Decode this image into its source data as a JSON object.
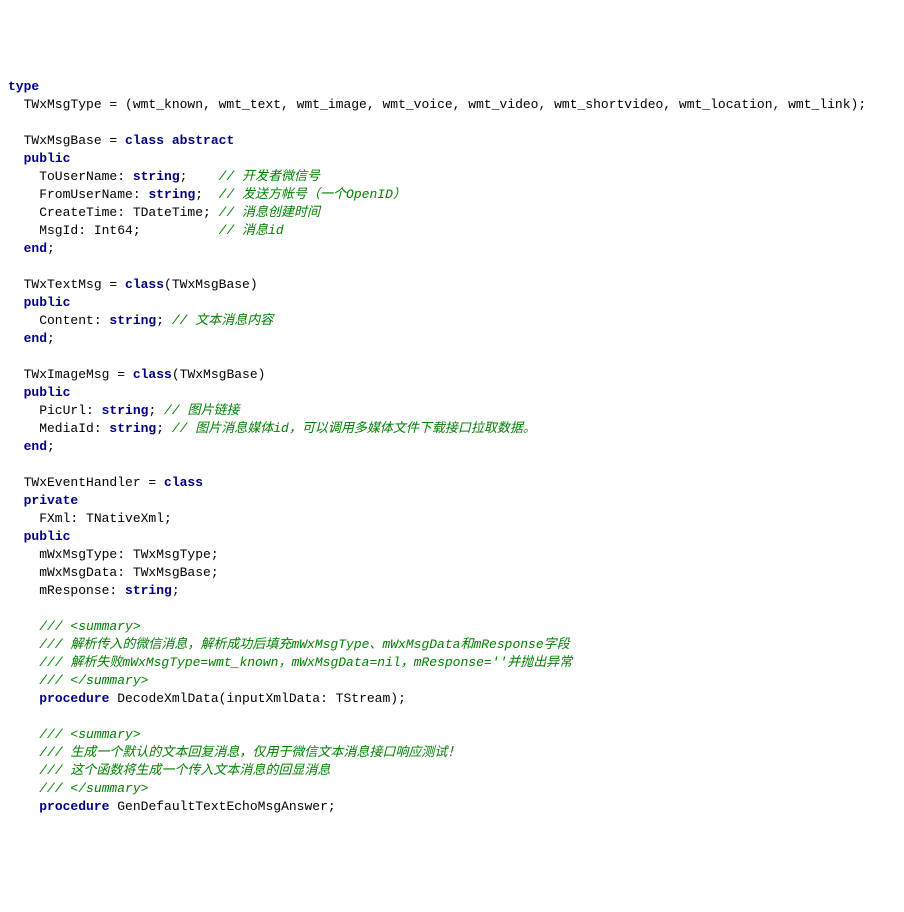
{
  "lines": [
    {
      "type": "kw",
      "text": "type"
    },
    {
      "segs": [
        {
          "t": "p",
          "v": "  TWxMsgType = (wmt_known, wmt_text, wmt_image, wmt_voice, wmt_video, wmt_shortvideo, wmt_location, wmt_link);"
        }
      ]
    },
    {
      "segs": [
        {
          "t": "p",
          "v": ""
        }
      ]
    },
    {
      "segs": [
        {
          "t": "p",
          "v": "  TWxMsgBase = "
        },
        {
          "t": "kw",
          "v": "class abstract"
        }
      ]
    },
    {
      "segs": [
        {
          "t": "p",
          "v": "  "
        },
        {
          "t": "kw",
          "v": "public"
        }
      ]
    },
    {
      "segs": [
        {
          "t": "p",
          "v": "    ToUserName: "
        },
        {
          "t": "typ",
          "v": "string"
        },
        {
          "t": "p",
          "v": ";    "
        },
        {
          "t": "cmt",
          "v": "// 开发者微信号"
        }
      ]
    },
    {
      "segs": [
        {
          "t": "p",
          "v": "    FromUserName: "
        },
        {
          "t": "typ",
          "v": "string"
        },
        {
          "t": "p",
          "v": ";  "
        },
        {
          "t": "cmt",
          "v": "// 发送方帐号（一个OpenID）"
        }
      ]
    },
    {
      "segs": [
        {
          "t": "p",
          "v": "    CreateTime: TDateTime; "
        },
        {
          "t": "cmt",
          "v": "// 消息创建时间"
        }
      ]
    },
    {
      "segs": [
        {
          "t": "p",
          "v": "    MsgId: Int64;          "
        },
        {
          "t": "cmt",
          "v": "// 消息id"
        }
      ]
    },
    {
      "segs": [
        {
          "t": "p",
          "v": "  "
        },
        {
          "t": "kw",
          "v": "end"
        },
        {
          "t": "p",
          "v": ";"
        }
      ]
    },
    {
      "segs": [
        {
          "t": "p",
          "v": ""
        }
      ]
    },
    {
      "segs": [
        {
          "t": "p",
          "v": "  TWxTextMsg = "
        },
        {
          "t": "kw",
          "v": "class"
        },
        {
          "t": "p",
          "v": "(TWxMsgBase)"
        }
      ]
    },
    {
      "segs": [
        {
          "t": "p",
          "v": "  "
        },
        {
          "t": "kw",
          "v": "public"
        }
      ]
    },
    {
      "segs": [
        {
          "t": "p",
          "v": "    Content: "
        },
        {
          "t": "typ",
          "v": "string"
        },
        {
          "t": "p",
          "v": "; "
        },
        {
          "t": "cmt",
          "v": "// 文本消息内容"
        }
      ]
    },
    {
      "segs": [
        {
          "t": "p",
          "v": "  "
        },
        {
          "t": "kw",
          "v": "end"
        },
        {
          "t": "p",
          "v": ";"
        }
      ]
    },
    {
      "segs": [
        {
          "t": "p",
          "v": ""
        }
      ]
    },
    {
      "segs": [
        {
          "t": "p",
          "v": "  TWxImageMsg = "
        },
        {
          "t": "kw",
          "v": "class"
        },
        {
          "t": "p",
          "v": "(TWxMsgBase)"
        }
      ]
    },
    {
      "segs": [
        {
          "t": "p",
          "v": "  "
        },
        {
          "t": "kw",
          "v": "public"
        }
      ]
    },
    {
      "segs": [
        {
          "t": "p",
          "v": "    PicUrl: "
        },
        {
          "t": "typ",
          "v": "string"
        },
        {
          "t": "p",
          "v": "; "
        },
        {
          "t": "cmt",
          "v": "// 图片链接"
        }
      ]
    },
    {
      "segs": [
        {
          "t": "p",
          "v": "    MediaId: "
        },
        {
          "t": "typ",
          "v": "string"
        },
        {
          "t": "p",
          "v": "; "
        },
        {
          "t": "cmt",
          "v": "// 图片消息媒体id，可以调用多媒体文件下载接口拉取数据。"
        }
      ]
    },
    {
      "segs": [
        {
          "t": "p",
          "v": "  "
        },
        {
          "t": "kw",
          "v": "end"
        },
        {
          "t": "p",
          "v": ";"
        }
      ]
    },
    {
      "segs": [
        {
          "t": "p",
          "v": ""
        }
      ]
    },
    {
      "segs": [
        {
          "t": "p",
          "v": "  TWxEventHandler = "
        },
        {
          "t": "kw",
          "v": "class"
        }
      ]
    },
    {
      "segs": [
        {
          "t": "p",
          "v": "  "
        },
        {
          "t": "kw",
          "v": "private"
        }
      ]
    },
    {
      "segs": [
        {
          "t": "p",
          "v": "    FXml: TNativeXml;"
        }
      ]
    },
    {
      "segs": [
        {
          "t": "p",
          "v": "  "
        },
        {
          "t": "kw",
          "v": "public"
        }
      ]
    },
    {
      "segs": [
        {
          "t": "p",
          "v": "    mWxMsgType: TWxMsgType;"
        }
      ]
    },
    {
      "segs": [
        {
          "t": "p",
          "v": "    mWxMsgData: TWxMsgBase;"
        }
      ]
    },
    {
      "segs": [
        {
          "t": "p",
          "v": "    mResponse: "
        },
        {
          "t": "typ",
          "v": "string"
        },
        {
          "t": "p",
          "v": ";"
        }
      ]
    },
    {
      "segs": [
        {
          "t": "p",
          "v": ""
        }
      ]
    },
    {
      "segs": [
        {
          "t": "p",
          "v": "    "
        },
        {
          "t": "cmt",
          "v": "/// <summary>"
        }
      ]
    },
    {
      "segs": [
        {
          "t": "p",
          "v": "    "
        },
        {
          "t": "cmt",
          "v": "/// 解析传入的微信消息，解析成功后填充mWxMsgType、mWxMsgData和mResponse字段"
        }
      ]
    },
    {
      "segs": [
        {
          "t": "p",
          "v": "    "
        },
        {
          "t": "cmt",
          "v": "/// 解析失败mWxMsgType=wmt_known，mWxMsgData=nil，mResponse=''并抛出异常"
        }
      ]
    },
    {
      "segs": [
        {
          "t": "p",
          "v": "    "
        },
        {
          "t": "cmt",
          "v": "/// </summary>"
        }
      ]
    },
    {
      "segs": [
        {
          "t": "p",
          "v": "    "
        },
        {
          "t": "kw",
          "v": "procedure"
        },
        {
          "t": "p",
          "v": " DecodeXmlData(inputXmlData: TStream);"
        }
      ]
    },
    {
      "segs": [
        {
          "t": "p",
          "v": ""
        }
      ]
    },
    {
      "segs": [
        {
          "t": "p",
          "v": "    "
        },
        {
          "t": "cmt",
          "v": "/// <summary>"
        }
      ]
    },
    {
      "segs": [
        {
          "t": "p",
          "v": "    "
        },
        {
          "t": "cmt",
          "v": "/// 生成一个默认的文本回复消息，仅用于微信文本消息接口响应测试！"
        }
      ]
    },
    {
      "segs": [
        {
          "t": "p",
          "v": "    "
        },
        {
          "t": "cmt",
          "v": "/// 这个函数将生成一个传入文本消息的回显消息"
        }
      ]
    },
    {
      "segs": [
        {
          "t": "p",
          "v": "    "
        },
        {
          "t": "cmt",
          "v": "/// </summary>"
        }
      ]
    },
    {
      "segs": [
        {
          "t": "p",
          "v": "    "
        },
        {
          "t": "kw",
          "v": "procedure"
        },
        {
          "t": "p",
          "v": " GenDefaultTextEchoMsgAnswer;"
        }
      ]
    }
  ]
}
